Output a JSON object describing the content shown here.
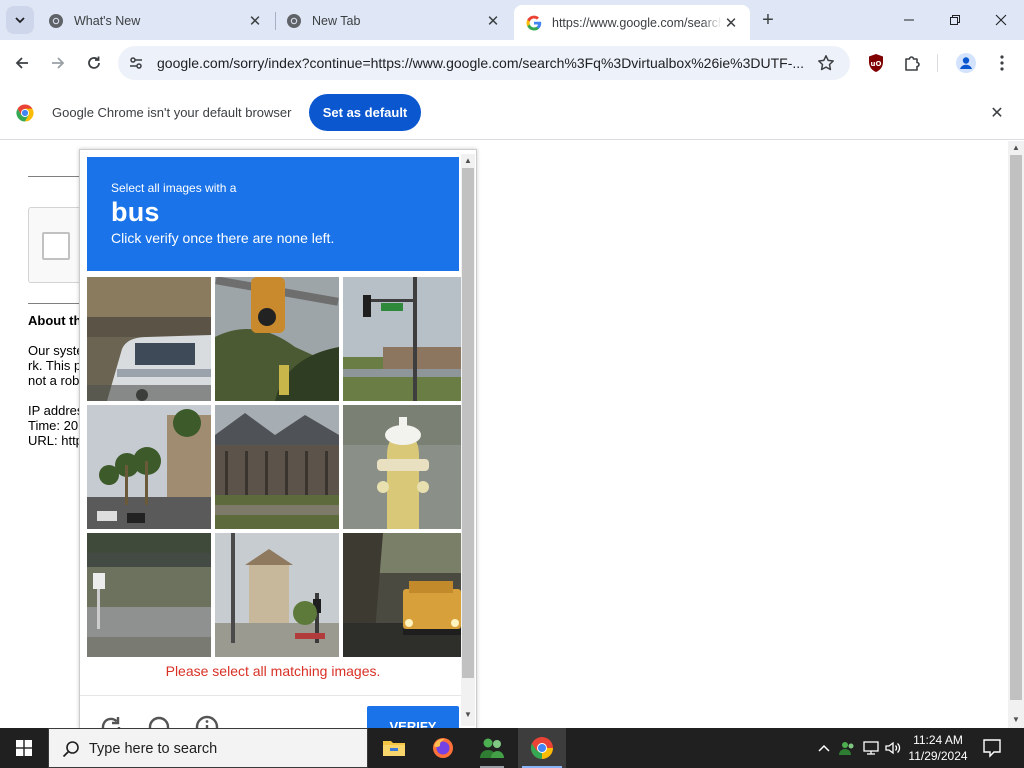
{
  "browser": {
    "tabs": [
      {
        "title": "What's New",
        "favicon": "chrome-icon",
        "active": false
      },
      {
        "title": "New Tab",
        "favicon": "chrome-icon",
        "active": false
      },
      {
        "title": "https://www.google.com/search?q=virtualbox",
        "favicon": "google-icon",
        "active": true
      }
    ],
    "address_bar": {
      "url": "google.com/sorry/index?continue=https://www.google.com/search%3Fq%3Dvirtualbox%26ie%3DUTF-..."
    },
    "infobar": {
      "message": "Google Chrome isn't your default browser",
      "button_label": "Set as default"
    }
  },
  "page": {
    "about_title": "About th",
    "about_lines": [
      "Our syste",
      "rk. This p",
      "not a rob"
    ],
    "info_lines": [
      "IP addres",
      "Time: 20",
      "URL: http"
    ]
  },
  "captcha": {
    "instruction": "Select all images with a",
    "target": "bus",
    "subtitle": "Click verify once there are none left.",
    "tiles": [
      {
        "scene": "bus-on-street"
      },
      {
        "scene": "traffic-light-closeup"
      },
      {
        "scene": "street-sign-intersection"
      },
      {
        "scene": "palm-tree-boulevard"
      },
      {
        "scene": "houses-behind-fence"
      },
      {
        "scene": "fire-hydrant"
      },
      {
        "scene": "highway-overpass"
      },
      {
        "scene": "street-with-houses"
      },
      {
        "scene": "yellow-vehicle-street"
      }
    ],
    "error_message": "Please select all matching images.",
    "verify_label": "VERIFY"
  },
  "taskbar": {
    "search_placeholder": "Type here to search",
    "time": "11:24 AM",
    "date": "11/29/2024"
  },
  "colors": {
    "captcha_blue": "#1a73e8",
    "set_default_blue": "#0b57d0",
    "error_red": "#d93025",
    "taskbar": "#202020"
  }
}
